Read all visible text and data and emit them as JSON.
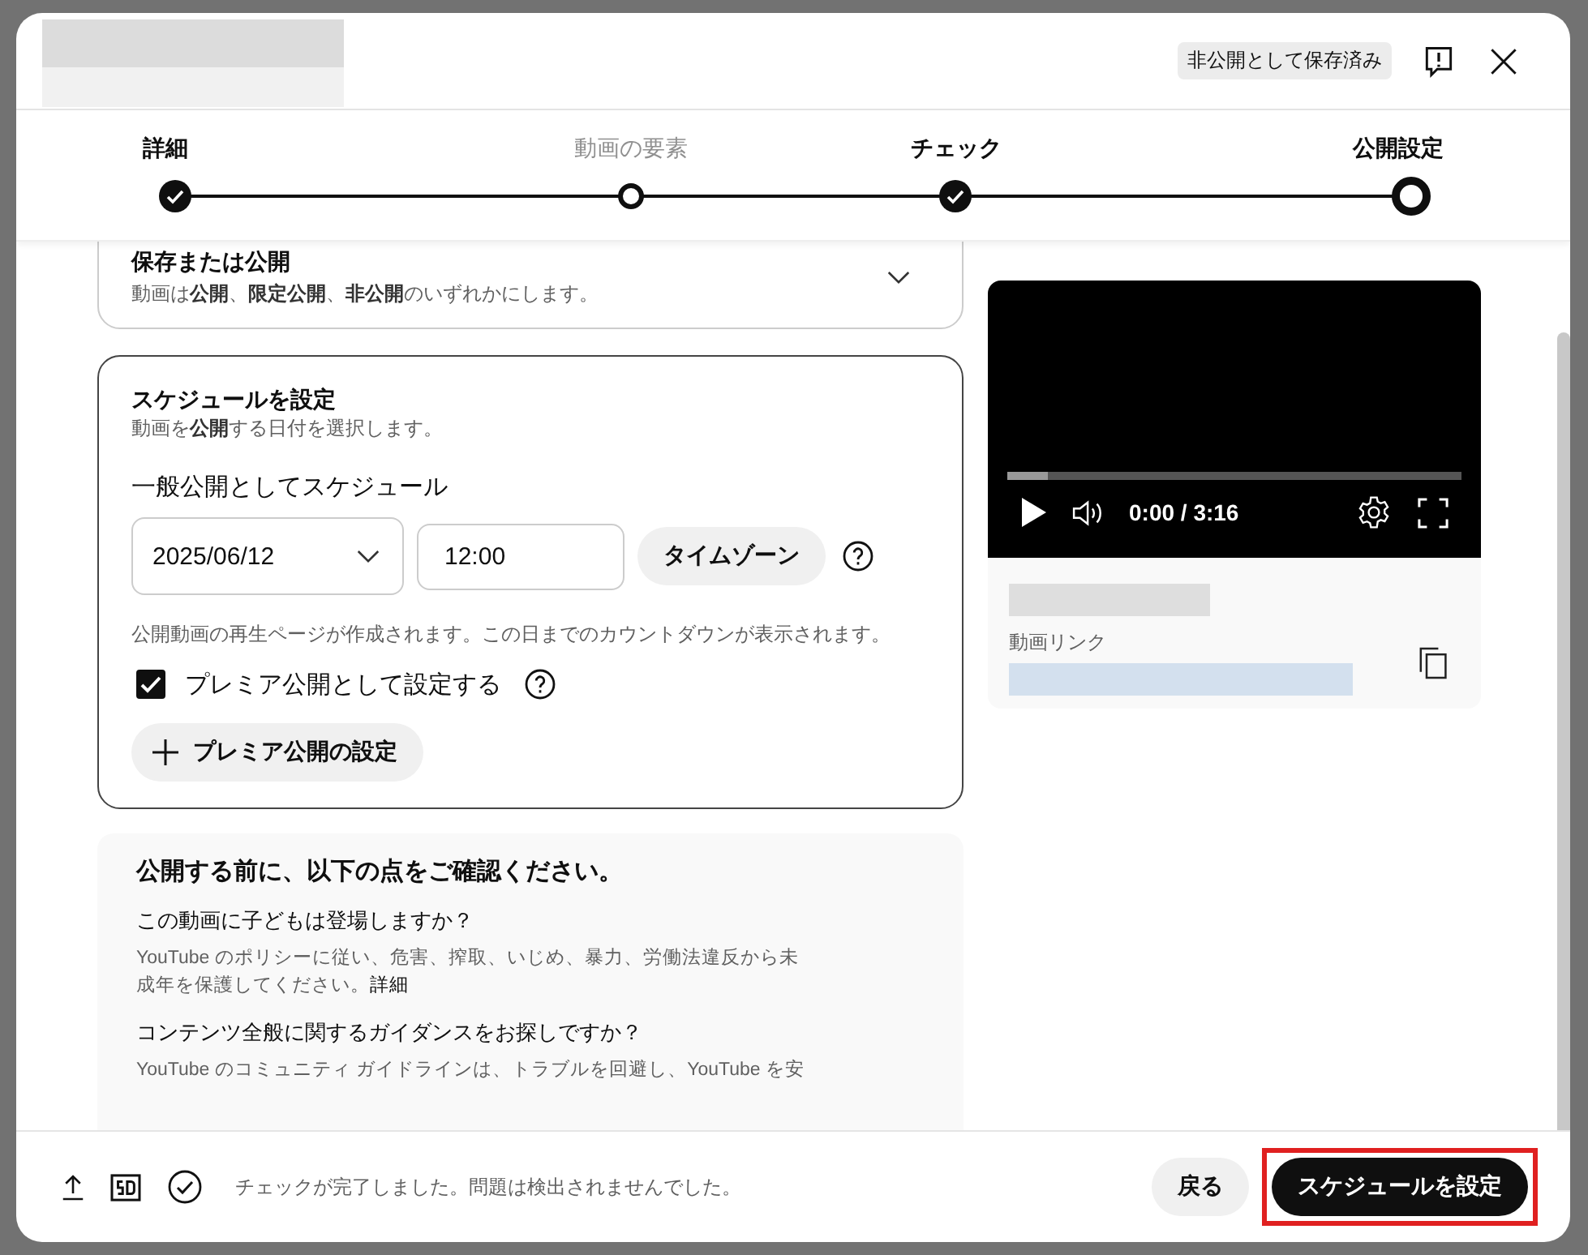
{
  "dialog": {
    "status_badge": "非公開として保存済み"
  },
  "steps": [
    {
      "label": "詳細",
      "kind": "done"
    },
    {
      "label": "動画の要素",
      "kind": "visited"
    },
    {
      "label": "チェック",
      "kind": "done"
    },
    {
      "label": "公開設定",
      "kind": "current"
    }
  ],
  "save_or_publish": {
    "title": "保存または公開",
    "description": "動画は**公開**、**限定公開**、**非公開**のいずれかにします。",
    "expanded": false
  },
  "schedule": {
    "title": "スケジュールを設定",
    "description": "動画を**公開**する日付を選択します。",
    "subtitle": "一般公開としてスケジュール",
    "date": "2025/06/12",
    "time": "12:00",
    "timezone_button": "タイムゾーン",
    "note": "公開動画の再生ページが作成されます。この日までのカウントダウンが表示されます。",
    "premiere": {
      "label": "プレミア公開として設定する",
      "checked": true
    },
    "premiere_settings_button": "プレミア公開の設定"
  },
  "checklist": {
    "title": "公開する前に、以下の点をご確認ください。",
    "items": [
      {
        "question": "この動画に子どもは登場しますか？",
        "text": "YouTube のポリシーに従い、危害、搾取、いじめ、暴力、労働法違反から未成年を保護してください。",
        "link": "詳細"
      },
      {
        "question": "コンテンツ全般に関するガイダンスをお探しですか？",
        "text": "YouTube のコミュニティ ガイドラインは、トラブルを回避し、YouTube を安"
      }
    ]
  },
  "video": {
    "time": "0:00 / 3:16",
    "progress": {
      "level": 0.09
    },
    "link_label": "動画リンク"
  },
  "footer": {
    "status": "チェックが完了しました。問題は検出されませんでした。",
    "back_button": "戻る",
    "primary_button": {
      "label": "スケジュールを設定",
      "highlighted": true
    }
  }
}
